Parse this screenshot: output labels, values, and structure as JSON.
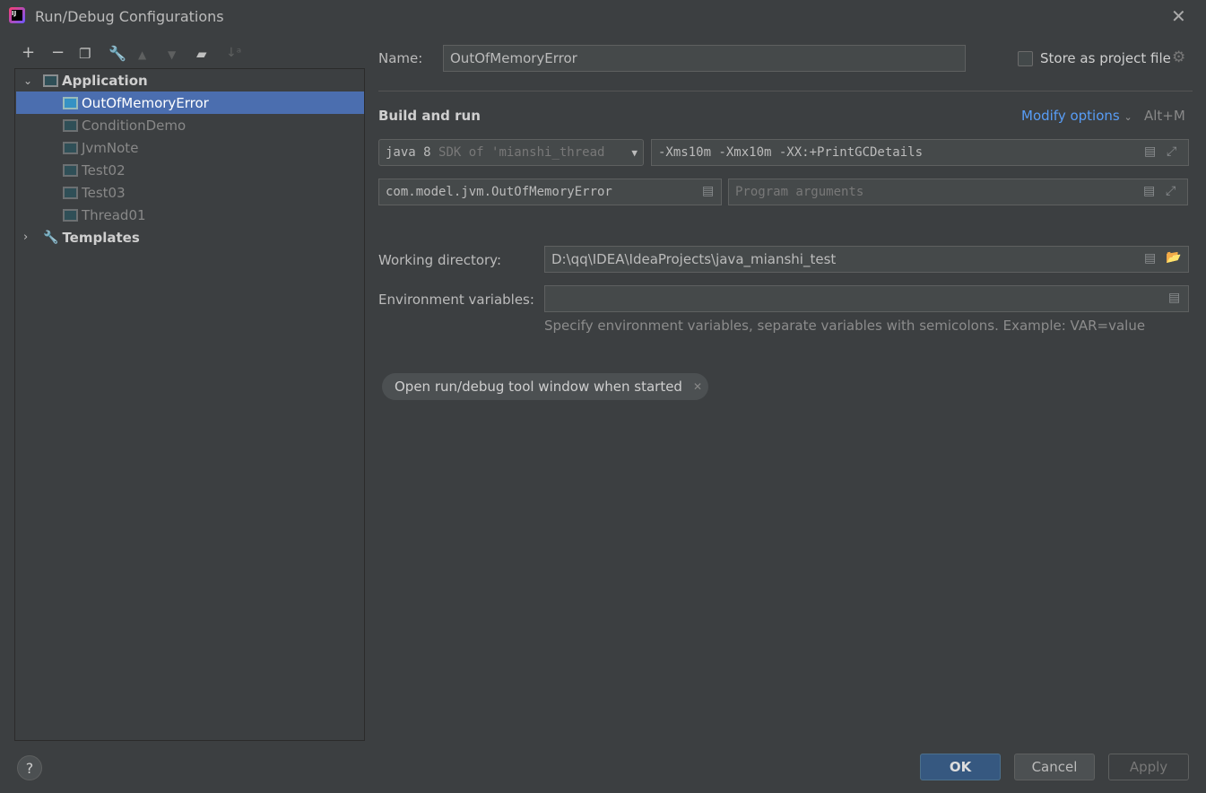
{
  "window": {
    "title": "Run/Debug Configurations"
  },
  "tree": {
    "group": "Application",
    "items": [
      "OutOfMemoryError",
      "ConditionDemo",
      "JvmNote",
      "Test02",
      "Test03",
      "Thread01"
    ],
    "templates": "Templates"
  },
  "form": {
    "name_label": "Name:",
    "name_value": "OutOfMemoryError",
    "store_label": "Store as project file",
    "section": "Build and run",
    "modify": "Modify options",
    "modify_shortcut": "Alt+M",
    "jdk_main": "java 8",
    "jdk_sub": "SDK of 'mianshi_thread",
    "vm_options": "-Xms10m -Xmx10m -XX:+PrintGCDetails",
    "main_class": "com.model.jvm.OutOfMemoryError",
    "program_args_placeholder": "Program arguments",
    "workdir_label": "Working directory:",
    "workdir_value": "D:\\qq\\IDEA\\IdeaProjects\\java_mianshi_test",
    "env_label": "Environment variables:",
    "env_value": "",
    "env_hint": "Specify environment variables, separate variables with semicolons. Example: VAR=value",
    "chip": "Open run/debug tool window when started"
  },
  "buttons": {
    "ok": "OK",
    "cancel": "Cancel",
    "apply": "Apply"
  },
  "colors": {
    "selection": "#4b6eaf",
    "ok": "#365880",
    "link": "#589df6"
  }
}
